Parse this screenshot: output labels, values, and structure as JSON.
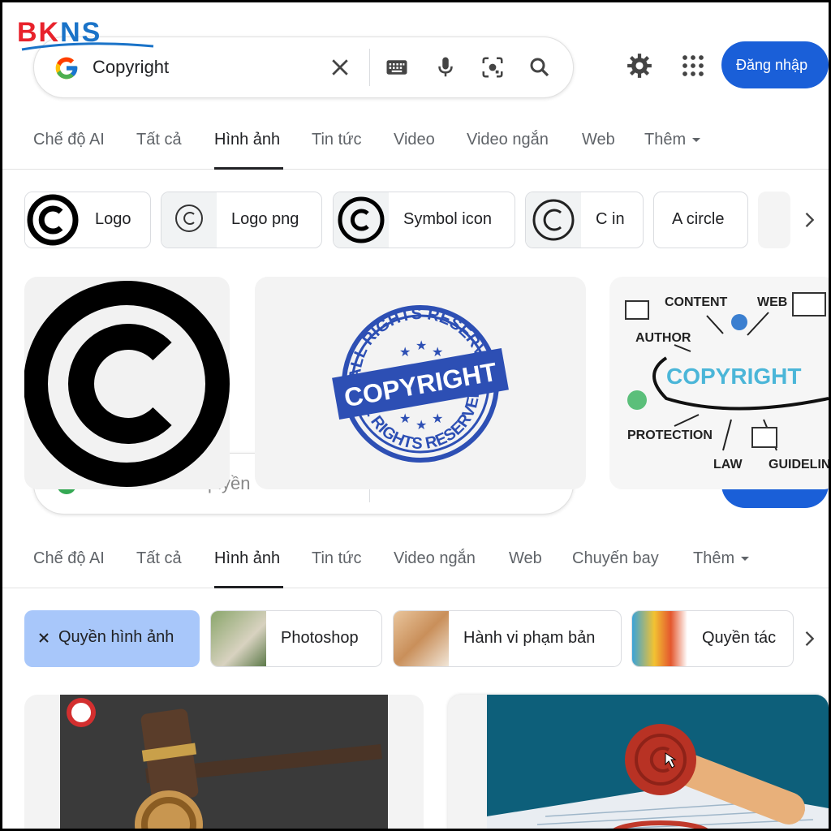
{
  "watermark": {
    "part1": "BK",
    "part2": "NS"
  },
  "top": {
    "query": "Copyright",
    "signin_label": "Đăng nhập",
    "tabs": [
      {
        "label": "Chế độ AI"
      },
      {
        "label": "Tất cả"
      },
      {
        "label": "Hình ảnh"
      },
      {
        "label": "Tin tức"
      },
      {
        "label": "Video"
      },
      {
        "label": "Video ngắn"
      },
      {
        "label": "Web"
      },
      {
        "label": "Thêm"
      }
    ],
    "active_tab": "Hình ảnh",
    "chips": [
      {
        "label": "Logo"
      },
      {
        "label": "Logo png"
      },
      {
        "label": "Symbol icon"
      },
      {
        "label": "C in"
      },
      {
        "label": "A circle"
      }
    ],
    "images": {
      "stamp": {
        "top": "ALL RIGHTS RESERVED",
        "center": "COPYRIGHT",
        "bottom": "ALL RIGHTS RESERVED"
      },
      "diagram": {
        "center": "COPYRIGHT",
        "words": [
          "CONTENT",
          "WEB",
          "AUTHOR",
          "PROTECTION",
          "LAW",
          "GUIDELIN"
        ]
      }
    }
  },
  "bottom": {
    "query": "hình ảnh bản quyền",
    "tabs": [
      {
        "label": "Chế độ AI"
      },
      {
        "label": "Tất cả"
      },
      {
        "label": "Hình ảnh"
      },
      {
        "label": "Tin tức"
      },
      {
        "label": "Video ngắn"
      },
      {
        "label": "Web"
      },
      {
        "label": "Chuyến bay"
      },
      {
        "label": "Thêm"
      }
    ],
    "active_tab": "Hình ảnh",
    "chips": [
      {
        "label": "Quyền hình ảnh",
        "selected": true
      },
      {
        "label": "Photoshop"
      },
      {
        "label": "Hành vi phạm bản"
      },
      {
        "label": "Quyền tác"
      }
    ]
  },
  "colors": {
    "accent_blue": "#1a5fd8",
    "selected_chip": "#a8c7fa",
    "bkns_red": "#e8222b",
    "bkns_blue": "#1a73c8"
  }
}
